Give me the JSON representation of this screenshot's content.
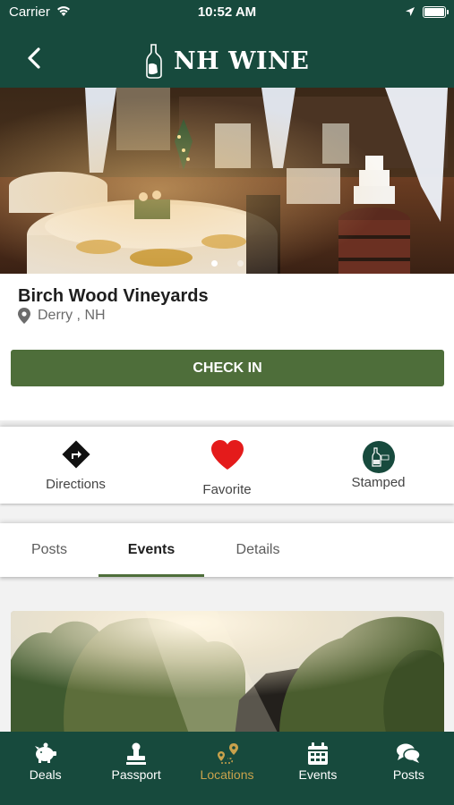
{
  "status_bar": {
    "carrier": "Carrier",
    "time": "10:52 AM"
  },
  "header": {
    "logo_text": "NH WINE"
  },
  "venue": {
    "name": "Birch Wood Vineyards",
    "location": "Derry , NH",
    "image_count": 2,
    "current_image": 1
  },
  "checkin_label": "CHECK IN",
  "actions": [
    {
      "label": "Directions",
      "icon": "directions-icon"
    },
    {
      "label": "Favorite",
      "icon": "heart-icon"
    },
    {
      "label": "Stamped",
      "icon": "stamp-icon"
    }
  ],
  "tabs": [
    {
      "label": "Posts"
    },
    {
      "label": "Events",
      "active": true
    },
    {
      "label": "Details"
    }
  ],
  "bottom_nav": [
    {
      "label": "Deals",
      "icon": "piggy-bank-icon"
    },
    {
      "label": "Passport",
      "icon": "stamp-icon"
    },
    {
      "label": "Locations",
      "icon": "map-route-icon",
      "active": true
    },
    {
      "label": "Events",
      "icon": "calendar-icon"
    },
    {
      "label": "Posts",
      "icon": "chat-bubbles-icon"
    }
  ],
  "colors": {
    "header_bg": "#174a3d",
    "button_green": "#4e6e3a",
    "favorite_red": "#e41b1b",
    "active_nav": "#c9a24c"
  }
}
